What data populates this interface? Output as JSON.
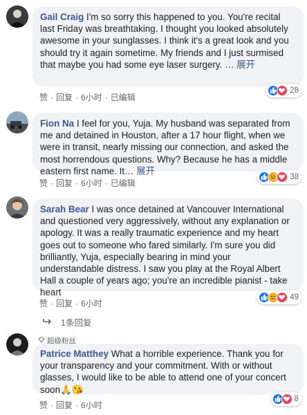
{
  "comments": [
    {
      "author": "Gail Craig",
      "text": "I'm so sorry this happened to you. You're recital last Friday was breathtaking. I thought you looked absolutely awesome in your sunglasses. I think it's a great look and you should try it again sometime. My friends and I just surmised that maybe you had some eye laser surgery. …",
      "more": "展开",
      "like": "赞",
      "reply": "回复",
      "time": "6小时",
      "edited": "已编辑",
      "reaction_count": "28"
    },
    {
      "author": "Fion Na",
      "text": "I feel for you, Yuja. My husband was separated from me and detained in Houston, after a 17 hour flight, when we were in transit, nearly missing our connection, and asked the most horrendous questions. Why? Because he has a middle eastern first name. It…",
      "more": "展开",
      "like": "赞",
      "reply": "回复",
      "time": "6小时",
      "edited": "已编辑",
      "reaction_count": "38"
    },
    {
      "author": "Sarah Bear",
      "text": "I was once detained at Vancouver International and questioned very aggressively, without any explanation or apology. It was a really traumatic experience and my heart goes out to someone who fared similarly. I'm sure you did brilliantly, Yuja, especially bearing in mind your understandable distress. I saw you play at the Royal Albert Hall a couple of years ago; you're an incredible pianist - take heart",
      "like": "赞",
      "reply": "回复",
      "time": "6小时",
      "reaction_count": "49"
    },
    {
      "author": "Patrice Matthey",
      "badge": "超级粉丝",
      "text": "What a horrible experience. Thank you for your transparency and your commitment. With or without glasses, I would like to be able to attend one of your concert soon🙏😘",
      "like": "赞",
      "reply": "回复",
      "time": "6小时",
      "reaction_count": "8"
    }
  ],
  "replies_link": "1条回复",
  "colors": {
    "author": "#385898",
    "bubble": "#f0f2f5",
    "meta": "#65676b",
    "like": "#1877f2",
    "love": "#f33e58",
    "sad": "#f7b125"
  }
}
